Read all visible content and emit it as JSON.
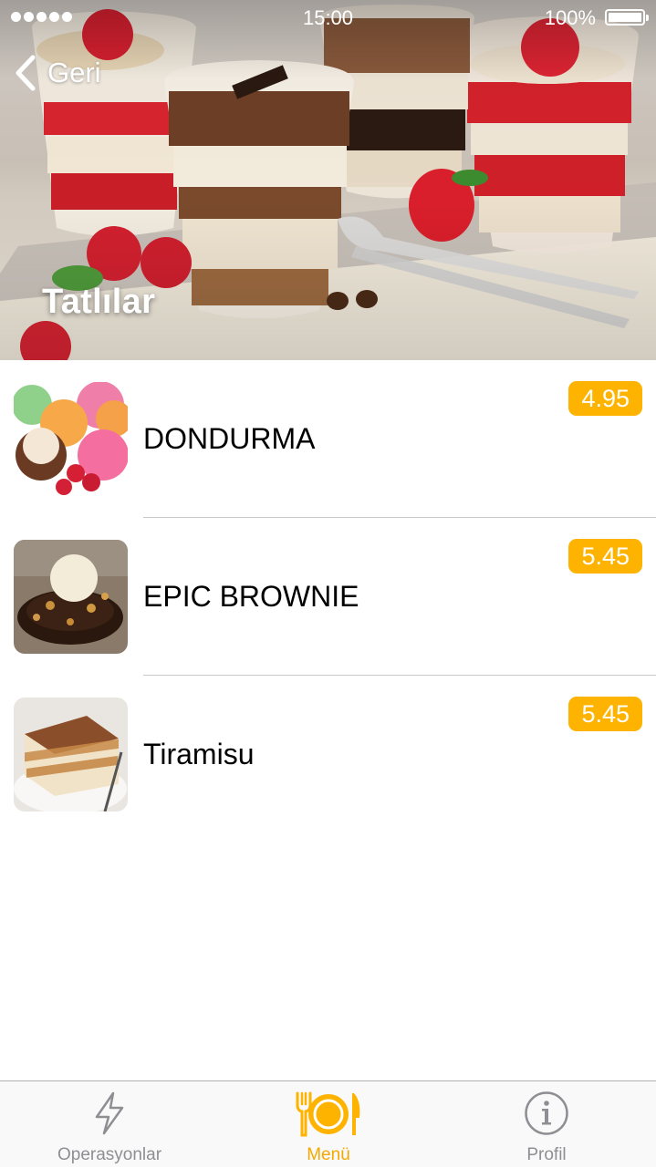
{
  "status_bar": {
    "time": "15:00",
    "battery": "100%",
    "signal_icon": "signal-dots-icon",
    "battery_icon": "battery-icon"
  },
  "header": {
    "back_label": "Geri",
    "back_icon": "chevron-left-icon",
    "title": "Tatlılar",
    "image": "dessert-cups-image"
  },
  "items": [
    {
      "name": "DONDURMA",
      "price": "4.95",
      "image": "ice-cream-scoops-image"
    },
    {
      "name": "EPIC BROWNIE",
      "price": "5.45",
      "image": "brownie-with-ice-cream-image"
    },
    {
      "name": "Tiramisu",
      "price": "5.45",
      "image": "tiramisu-slice-image"
    }
  ],
  "tabs": [
    {
      "label": "Operasyonlar",
      "icon": "lightning-icon",
      "active": false
    },
    {
      "label": "Menü",
      "icon": "plate-fork-knife-icon",
      "active": true
    },
    {
      "label": "Profil",
      "icon": "info-icon",
      "active": false
    }
  ],
  "colors": {
    "accent": "#fdb300",
    "tab_active": "#f5a800",
    "tab_inactive": "#8e8e93"
  }
}
